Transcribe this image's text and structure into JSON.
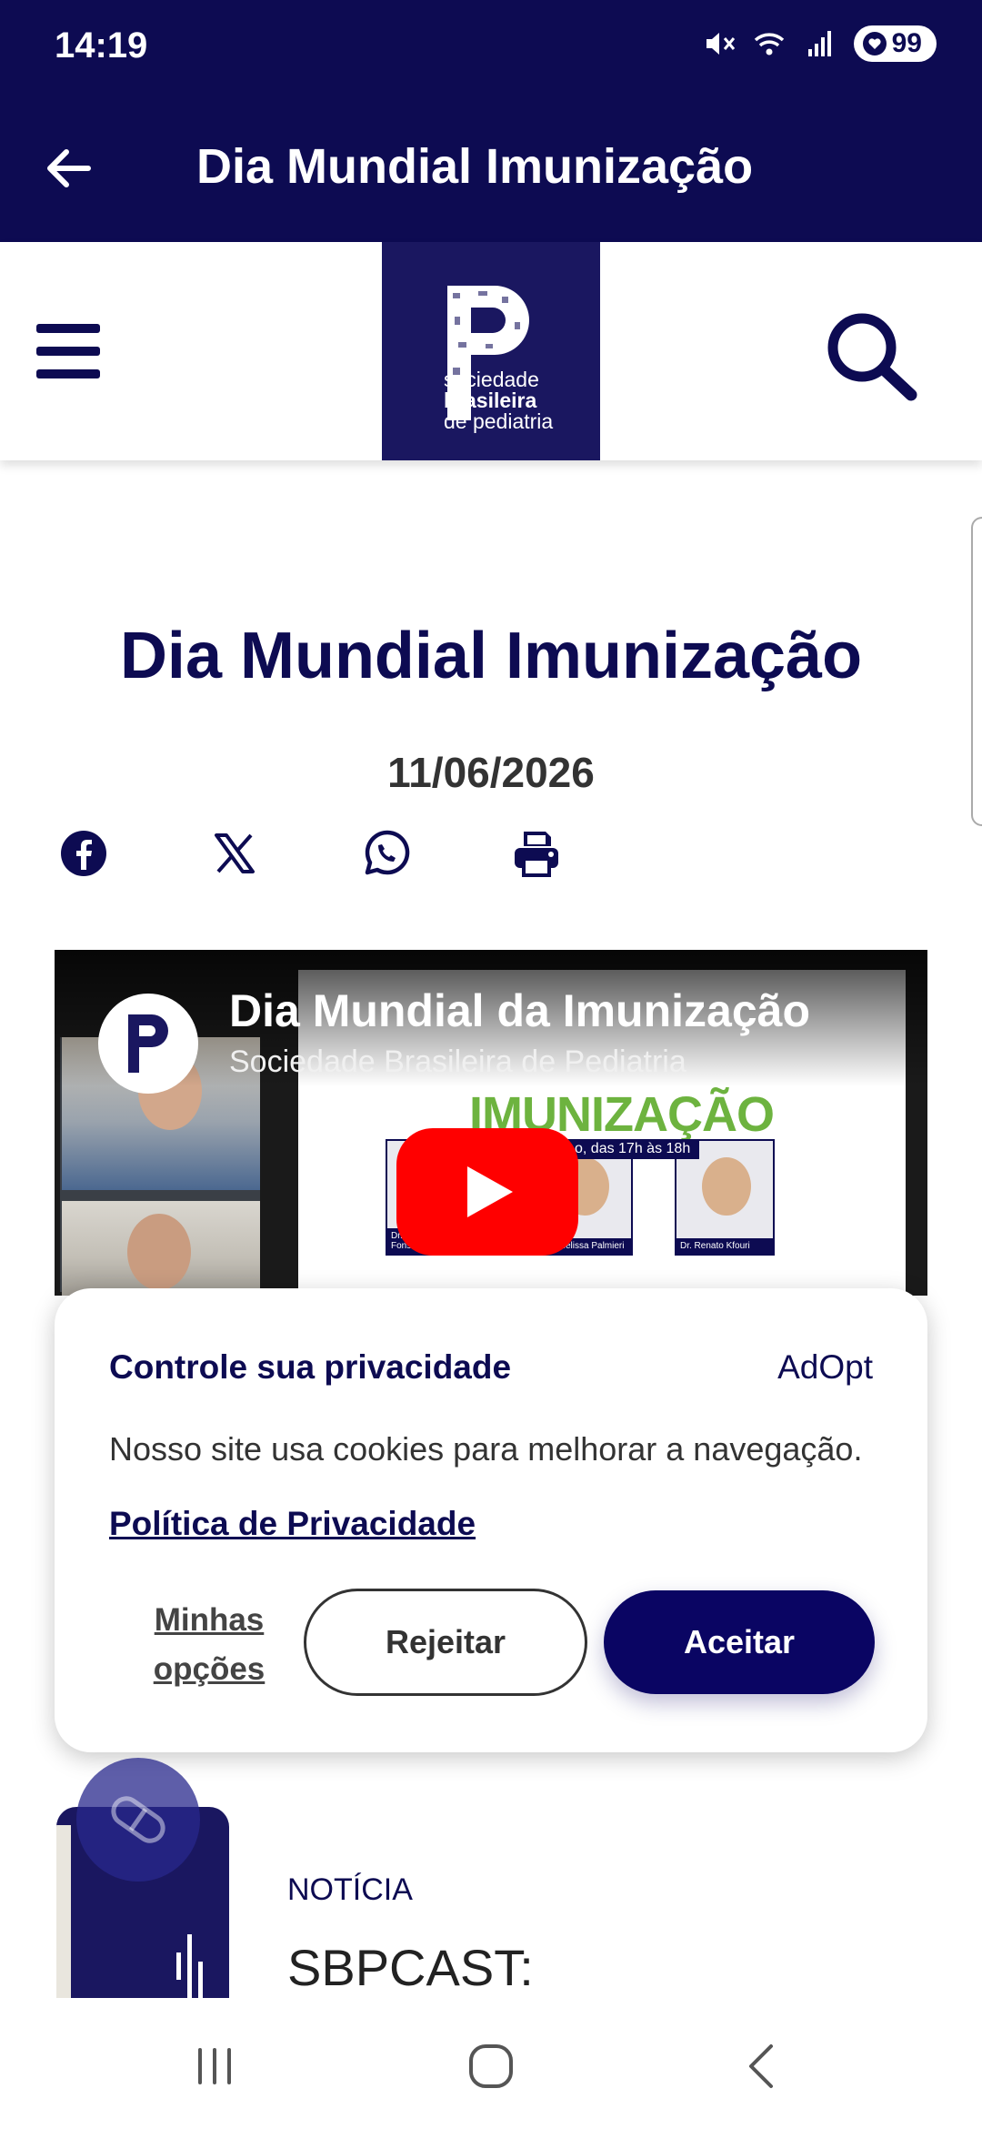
{
  "status_bar": {
    "time": "14:19",
    "battery_level": "99",
    "icons": [
      "mute-icon",
      "wifi-icon",
      "signal-icon",
      "battery-icon"
    ]
  },
  "app_bar": {
    "title": "Dia Mundial Imunização",
    "back_icon": "arrow-left-icon"
  },
  "site_header": {
    "menu_icon": "hamburger-icon",
    "logo_lines": [
      "sociedade",
      "brasileira",
      "de pediatria"
    ],
    "search_icon": "search-icon",
    "brand_color": "#0d0b52"
  },
  "article": {
    "title": "Dia Mundial Imunização",
    "date": "11/06/2026",
    "share_icons": [
      "facebook-icon",
      "x-icon",
      "whatsapp-icon",
      "print-icon"
    ]
  },
  "video": {
    "title": "Dia Mundial da Imunização",
    "channel": "Sociedade Brasileira de Pediatria",
    "slide_heading": "IMUNIZAÇÃO",
    "slide_subheading": "o, das 17h às 18h",
    "speakers": [
      {
        "name": "Dr. Eduardo Jorge Fonseca"
      },
      {
        "name": "Dra. Melissa Palmieri"
      },
      {
        "name": "Dr. Renato Kfouri"
      }
    ]
  },
  "cookie_dialog": {
    "title": "Controle sua privacidade",
    "brand": "AdOpt",
    "message": "Nosso site usa cookies para melhorar a navegação.",
    "policy_link": "Política de Privacidade",
    "options_label": "Minhas opções",
    "reject_label": "Rejeitar",
    "accept_label": "Aceitar"
  },
  "news_teaser": {
    "category": "NOTÍCIA",
    "title": "SBPCAST:"
  },
  "nav_bar": {
    "icons": [
      "recent-apps-icon",
      "home-icon",
      "back-nav-icon"
    ]
  }
}
